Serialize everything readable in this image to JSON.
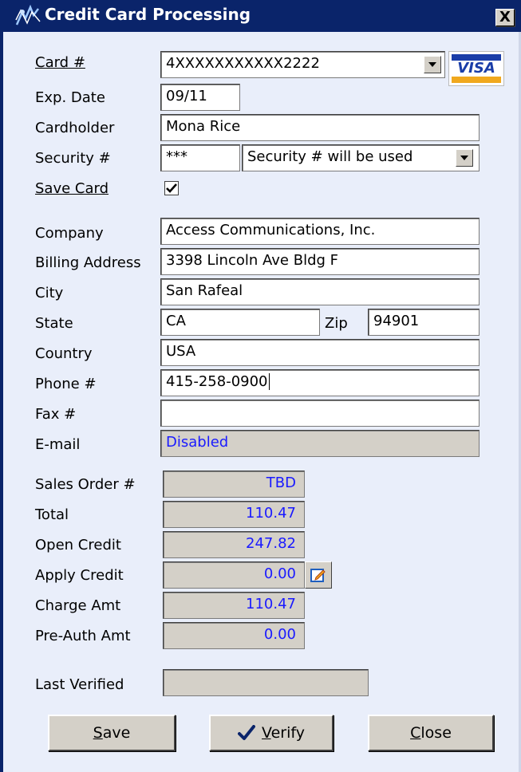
{
  "window": {
    "title": "Credit Card Processing",
    "close_glyph": "X"
  },
  "card": {
    "card_label": "Card #",
    "card_number": "4XXXXXXXXXXX2222",
    "card_brand": "VISA",
    "exp_label": "Exp. Date",
    "exp_value": "09/11",
    "holder_label": "Cardholder",
    "holder_value": "Mona Rice",
    "security_label": "Security #",
    "security_value": "***",
    "security_option": "Security # will be used",
    "save_card_label": "Save Card",
    "save_card_checked": true
  },
  "billing": {
    "company_label": "Company",
    "company_value": "Access Communications, Inc.",
    "address_label": "Billing Address",
    "address_value": "3398 Lincoln Ave Bldg F",
    "city_label": "City",
    "city_value": "San Rafeal",
    "state_label": "State",
    "state_value": "CA",
    "zip_label": "Zip",
    "zip_value": "94901",
    "country_label": "Country",
    "country_value": "USA",
    "phone_label": "Phone #",
    "phone_value": "415-258-0900",
    "fax_label": "Fax #",
    "fax_value": "",
    "email_label": "E-mail",
    "email_value": "Disabled"
  },
  "amounts": {
    "sales_order_label": "Sales Order #",
    "sales_order_value": "TBD",
    "total_label": "Total",
    "total_value": "110.47",
    "open_credit_label": "Open Credit",
    "open_credit_value": "247.82",
    "apply_credit_label": "Apply Credit",
    "apply_credit_value": "0.00",
    "charge_label": "Charge Amt",
    "charge_value": "110.47",
    "preauth_label": "Pre-Auth Amt",
    "preauth_value": "0.00",
    "last_verified_label": "Last Verified",
    "last_verified_value": ""
  },
  "buttons": {
    "save_mnemonic": "S",
    "save_rest": "ave",
    "verify_mnemonic": "V",
    "verify_rest": "erify",
    "close_mnemonic": "C",
    "close_rest": "lose"
  },
  "colors": {
    "title_bar": "#0a246a",
    "dialog_bg": "#e9eefa",
    "disabled_field": "#d4d0c8",
    "value_blue": "#1a1aff"
  }
}
